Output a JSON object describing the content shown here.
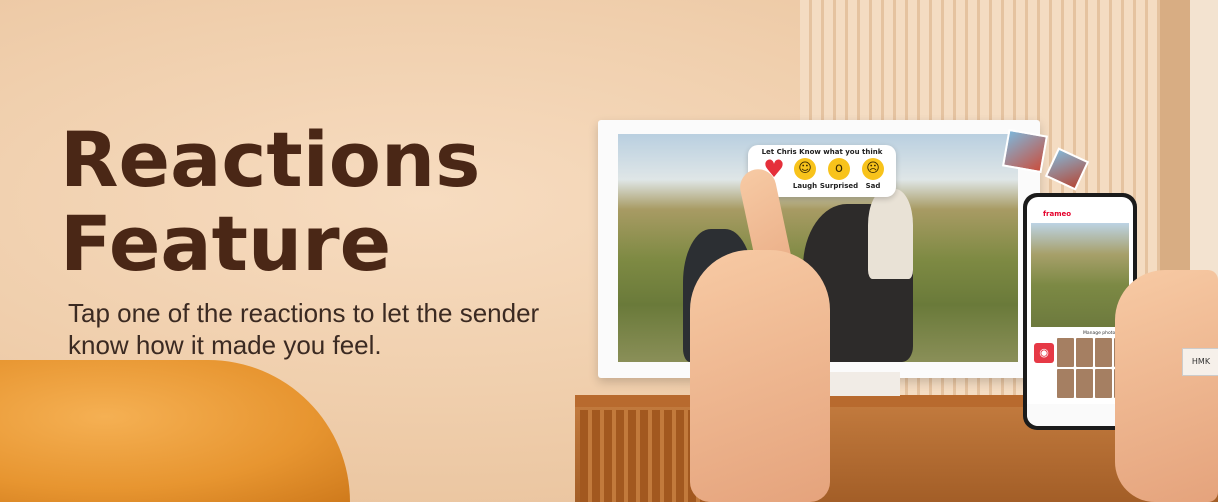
{
  "banner": {
    "title": "Reactions Feature",
    "subtitle": "Tap one of the reactions to let the sender know how it made you feel."
  },
  "frame_popup": {
    "title": "Let Chris Know what you think",
    "reactions": [
      {
        "icon": "heart-icon",
        "label": ""
      },
      {
        "icon": "laugh-emoji-icon",
        "label": "Laugh"
      },
      {
        "icon": "surprised-emoji-icon",
        "label": "Surprised"
      },
      {
        "icon": "sad-emoji-icon",
        "label": "Sad"
      }
    ]
  },
  "phone_app": {
    "logo": "frameo",
    "manage_label": "Manage photos"
  },
  "colors": {
    "title": "#4a2716",
    "brand_red": "#e4002b",
    "emoji_yellow": "#f8c31b"
  }
}
